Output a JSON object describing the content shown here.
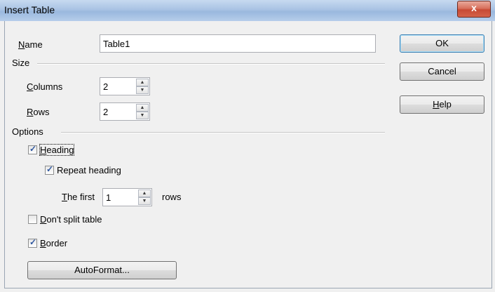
{
  "window": {
    "title": "Insert Table",
    "close_glyph": "x"
  },
  "name": {
    "label": "Name",
    "value": "Table1"
  },
  "size": {
    "heading": "Size",
    "columns": {
      "label": "Columns",
      "value": "2"
    },
    "rows": {
      "label": "Rows",
      "value": "2"
    }
  },
  "options": {
    "heading": "Options",
    "heading_cb": {
      "label": "Heading",
      "checked": true
    },
    "repeat_heading_cb": {
      "label": "Repeat heading",
      "checked": true
    },
    "the_first": {
      "label": "The first",
      "value": "1",
      "suffix": "rows"
    },
    "dont_split_cb": {
      "label": "Don't split table",
      "checked": false
    },
    "border_cb": {
      "label": "Border",
      "checked": true
    }
  },
  "buttons": {
    "autoformat": "AutoFormat...",
    "ok": "OK",
    "cancel": "Cancel",
    "help": "Help"
  },
  "icons": {
    "spin_up": "up-arrow",
    "spin_down": "down-arrow",
    "check": "checkmark"
  }
}
